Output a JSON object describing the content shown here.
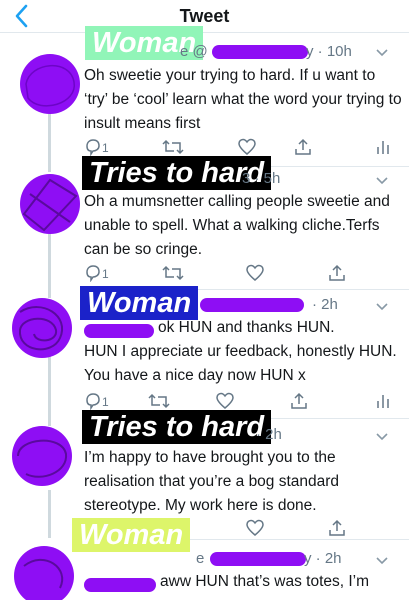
{
  "header": {
    "title": "Tweet"
  },
  "tweets": [
    {
      "label": "Woman",
      "meta": "e @",
      "time": "y · 10h",
      "body": "Oh sweetie your trying to hard.  If u want to ‘try’ be ‘cool’ learn what the word your trying to insult means first",
      "reply_count": "1"
    },
    {
      "label": "Tries to hard",
      "time": "3 · 5h",
      "body": "Oh a mumsnetter calling people sweetie and unable to spell. What a walking cliche.Terfs can be so cringe.",
      "reply_count": "1"
    },
    {
      "label": "Woman",
      "time": "· 2h",
      "body_first": "ok HUN and thanks HUN.",
      "body_rest": "HUN I appreciate ur feedback, honestly HUN. You have a nice day now HUN x",
      "reply_count": "1"
    },
    {
      "label": "Tries to hard",
      "time": "· 2h",
      "body": "I’m happy to have brought you to the realisation that you’re a bog standard stereotype. My work here is done."
    },
    {
      "label": "Woman",
      "meta": "e",
      "time": "y · 2h",
      "body_first": "aww HUN that’s was totes, I’m"
    }
  ],
  "colors": {
    "accent": "#1da1f2",
    "redaction": "#8e0ef4",
    "muted": "#657786"
  },
  "icons": [
    "back-chevron-icon",
    "reply-icon",
    "retweet-icon",
    "like-icon",
    "share-icon",
    "analytics-icon",
    "chevron-down-icon"
  ]
}
